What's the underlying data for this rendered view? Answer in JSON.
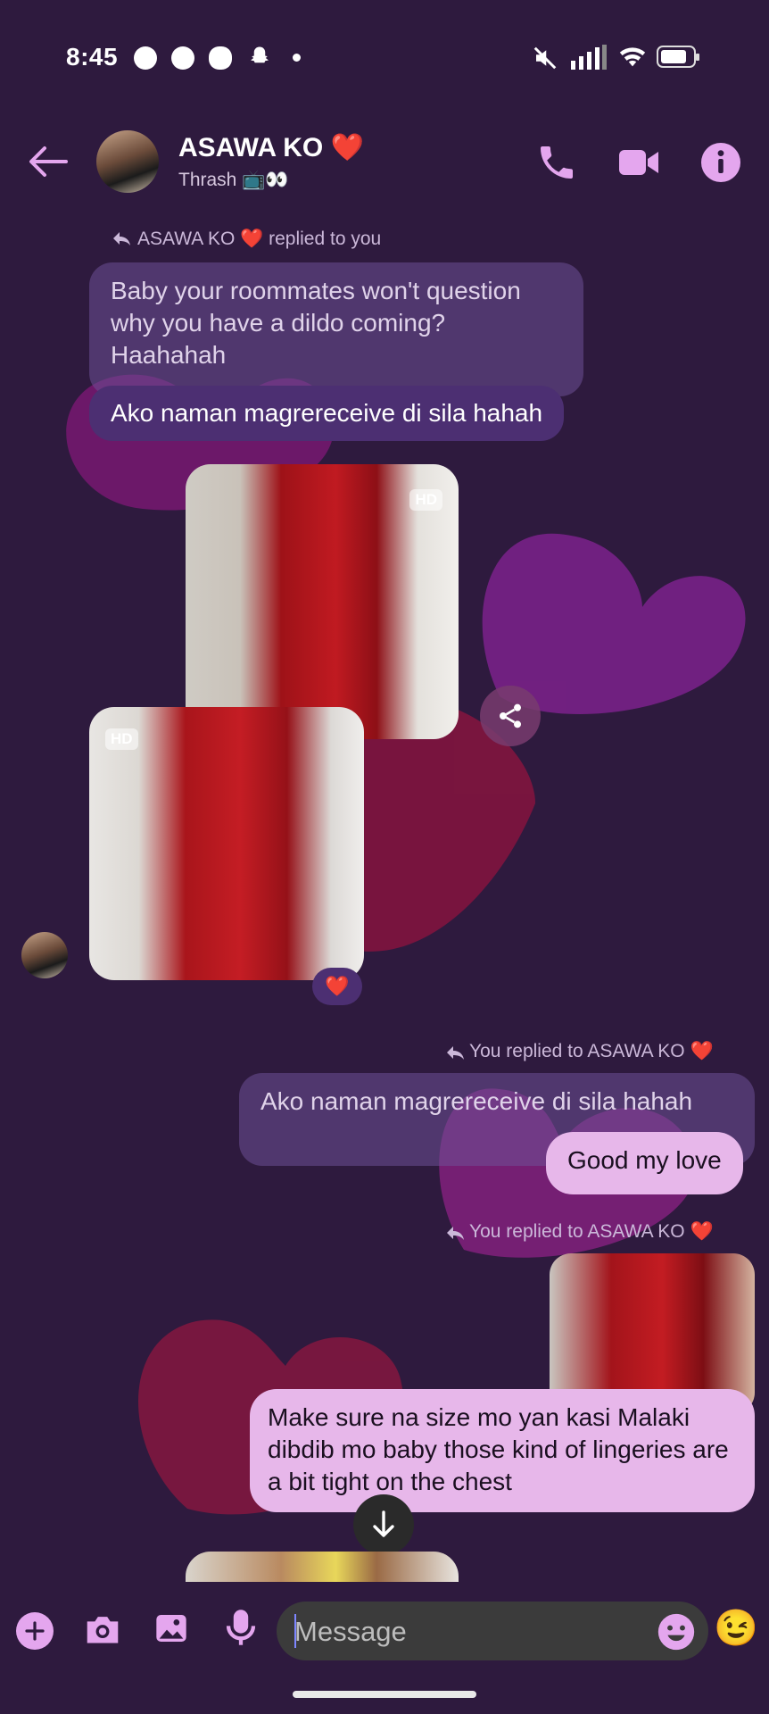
{
  "status_bar": {
    "time": "8:45"
  },
  "header": {
    "contact_name": "ASAWA KO ❤️",
    "subtitle": "Thrash 📺👀"
  },
  "messages": {
    "reply1_label": "ASAWA KO ❤️ replied to you",
    "quoted1": "Baby your roommates won't question why you have a dildo coming? Haahahah",
    "incoming1": "Ako naman magrereceive di sila hahah",
    "photo_badge": "HD",
    "reaction": "❤️",
    "reply2_label": "You replied to ASAWA KO ❤️",
    "quoted2": "Ako naman magrereceive di sila hahah",
    "outgoing1": "Good my love",
    "reply3_label": "You replied to ASAWA KO ❤️",
    "outgoing2": "Make sure na size mo yan kasi Malaki dibdib mo baby those kind of lingeries are a bit tight on the chest"
  },
  "composer": {
    "placeholder": "Message",
    "wink_emoji": "😉"
  },
  "colors": {
    "background": "#2e1a3e",
    "accent": "#e7b7ea",
    "incoming_bubble": "#4c2f72",
    "header_icons": "#e4a6ee"
  }
}
